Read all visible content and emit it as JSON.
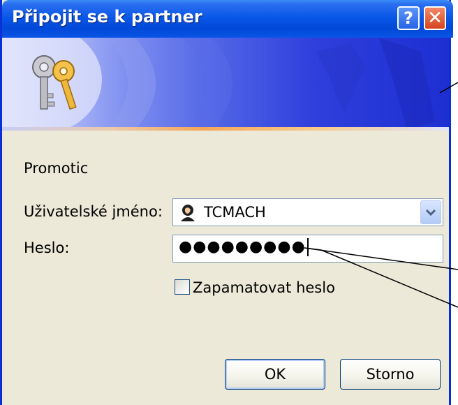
{
  "window": {
    "title": "Připojit se k partner"
  },
  "titlebar": {
    "help_label": "?",
    "close_label": "✕"
  },
  "form": {
    "server_name": "Promotic",
    "username_label": "Uživatelské jméno:",
    "username_value": "TCMACH",
    "password_label": "Heslo:",
    "password_value": "●●●●●●●●●",
    "remember_label": "Zapamatovat heslo",
    "remember_checked": false
  },
  "buttons": {
    "ok_label": "OK",
    "cancel_label": "Storno"
  },
  "icons": [
    "keys-icon",
    "user-icon",
    "chevron-down-icon",
    "help-icon",
    "close-icon"
  ],
  "colors": {
    "titlebar": "#0a58e8",
    "window_bg": "#ece9d8",
    "close": "#d6431e",
    "border": "#0831d9"
  }
}
